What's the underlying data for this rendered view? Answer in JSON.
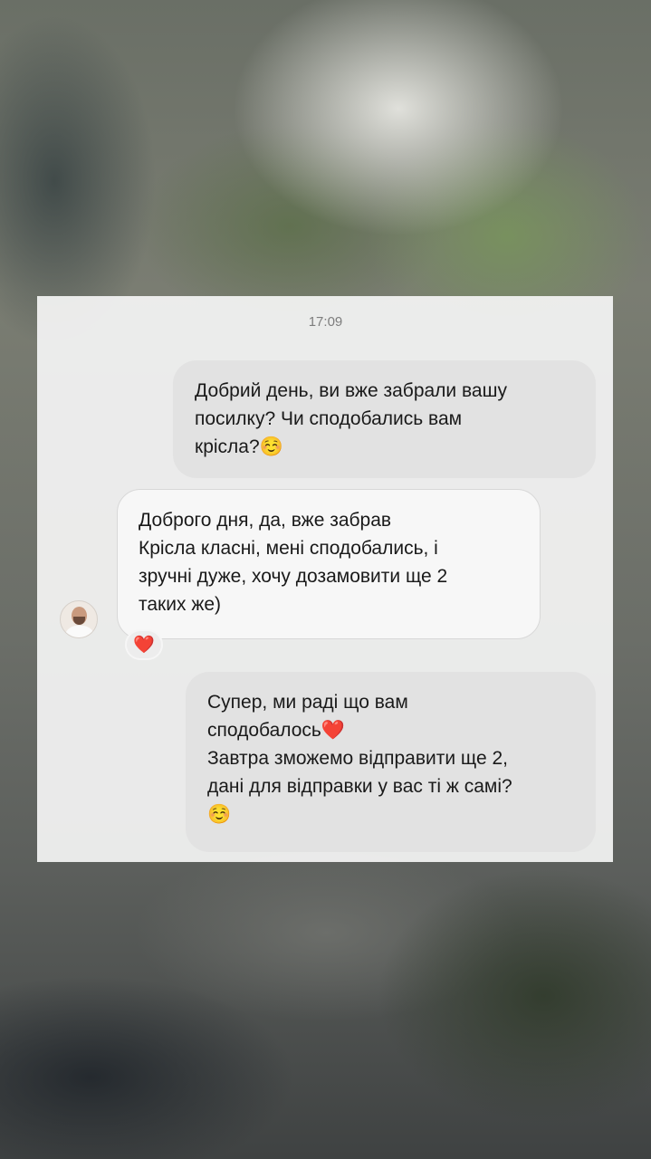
{
  "chat": {
    "timestamp": "17:09",
    "messages": [
      {
        "direction": "outgoing",
        "text": "Добрий день, ви вже забрали вашу\nпосилку? Чи сподобались вам\nкрісла?☺️"
      },
      {
        "direction": "incoming",
        "text": "Доброго дня, да, вже забрав\nКрісла класні, мені сподобались, і\nзручні дуже, хочу дозамовити ще 2\nтаких же)",
        "reaction": "❤️"
      },
      {
        "direction": "outgoing",
        "text": "Супер, ми раді що вам\nсподобалось❤️\nЗавтра зможемо відправити ще 2,\nдані для відправки у вас ті ж самі?\n☺️"
      }
    ],
    "avatar_icon": "user-avatar-icon"
  },
  "colors": {
    "outgoing_bubble": "#e1e1e1",
    "incoming_bubble": "#f8f8f8",
    "reaction_heart": "#e0282e"
  }
}
